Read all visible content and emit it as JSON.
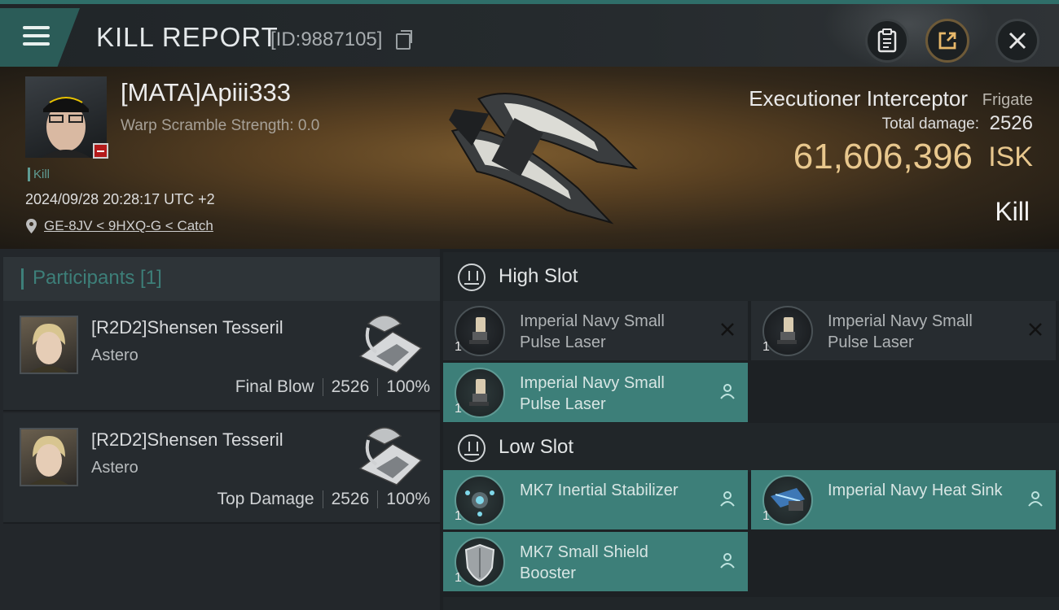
{
  "header": {
    "title": "KILL REPORT",
    "report_id": "[ID:9887105]",
    "icons": [
      "menu-icon",
      "copy-icon",
      "clipboard-icon",
      "share-icon",
      "close-icon"
    ]
  },
  "victim": {
    "name": "[MATA]Apiii333",
    "warp_scramble": "Warp Scramble Strength: 0.0",
    "kill_tag": "Kill",
    "datetime": "2024/09/28 20:28:17 UTC +2",
    "location": "GE-8JV < 9HXQ-G < Catch"
  },
  "ship": {
    "name": "Executioner Interceptor",
    "class": "Frigate",
    "total_damage_label": "Total damage:",
    "total_damage": "2526",
    "isk_value": "61,606,396",
    "isk_unit": "ISK",
    "result": "Kill"
  },
  "participants": {
    "header": "Participants [1]",
    "rows": [
      {
        "name": "[R2D2]Shensen Tesseril",
        "ship": "Astero",
        "role": "Final Blow",
        "damage": "2526",
        "percent": "100%"
      },
      {
        "name": "[R2D2]Shensen Tesseril",
        "ship": "Astero",
        "role": "Top Damage",
        "damage": "2526",
        "percent": "100%"
      }
    ]
  },
  "slots": {
    "high": {
      "title": "High Slot",
      "items": [
        {
          "name": "Imperial Navy Small Pulse Laser",
          "qty": "1",
          "status": "destroyed"
        },
        {
          "name": "Imperial Navy Small Pulse Laser",
          "qty": "1",
          "status": "destroyed"
        },
        {
          "name": "Imperial Navy Small Pulse Laser",
          "qty": "1",
          "status": "dropped"
        }
      ]
    },
    "low": {
      "title": "Low Slot",
      "items": [
        {
          "name": "MK7 Inertial Stabilizer",
          "qty": "1",
          "status": "dropped"
        },
        {
          "name": "Imperial Navy Heat Sink",
          "qty": "1",
          "status": "dropped"
        },
        {
          "name": "MK7 Small Shield Booster",
          "qty": "1",
          "status": "dropped"
        }
      ]
    }
  },
  "colors": {
    "accent": "#3d7f79",
    "isk_gold": "#e8c78d",
    "victim_badge": "#b31a1a"
  }
}
